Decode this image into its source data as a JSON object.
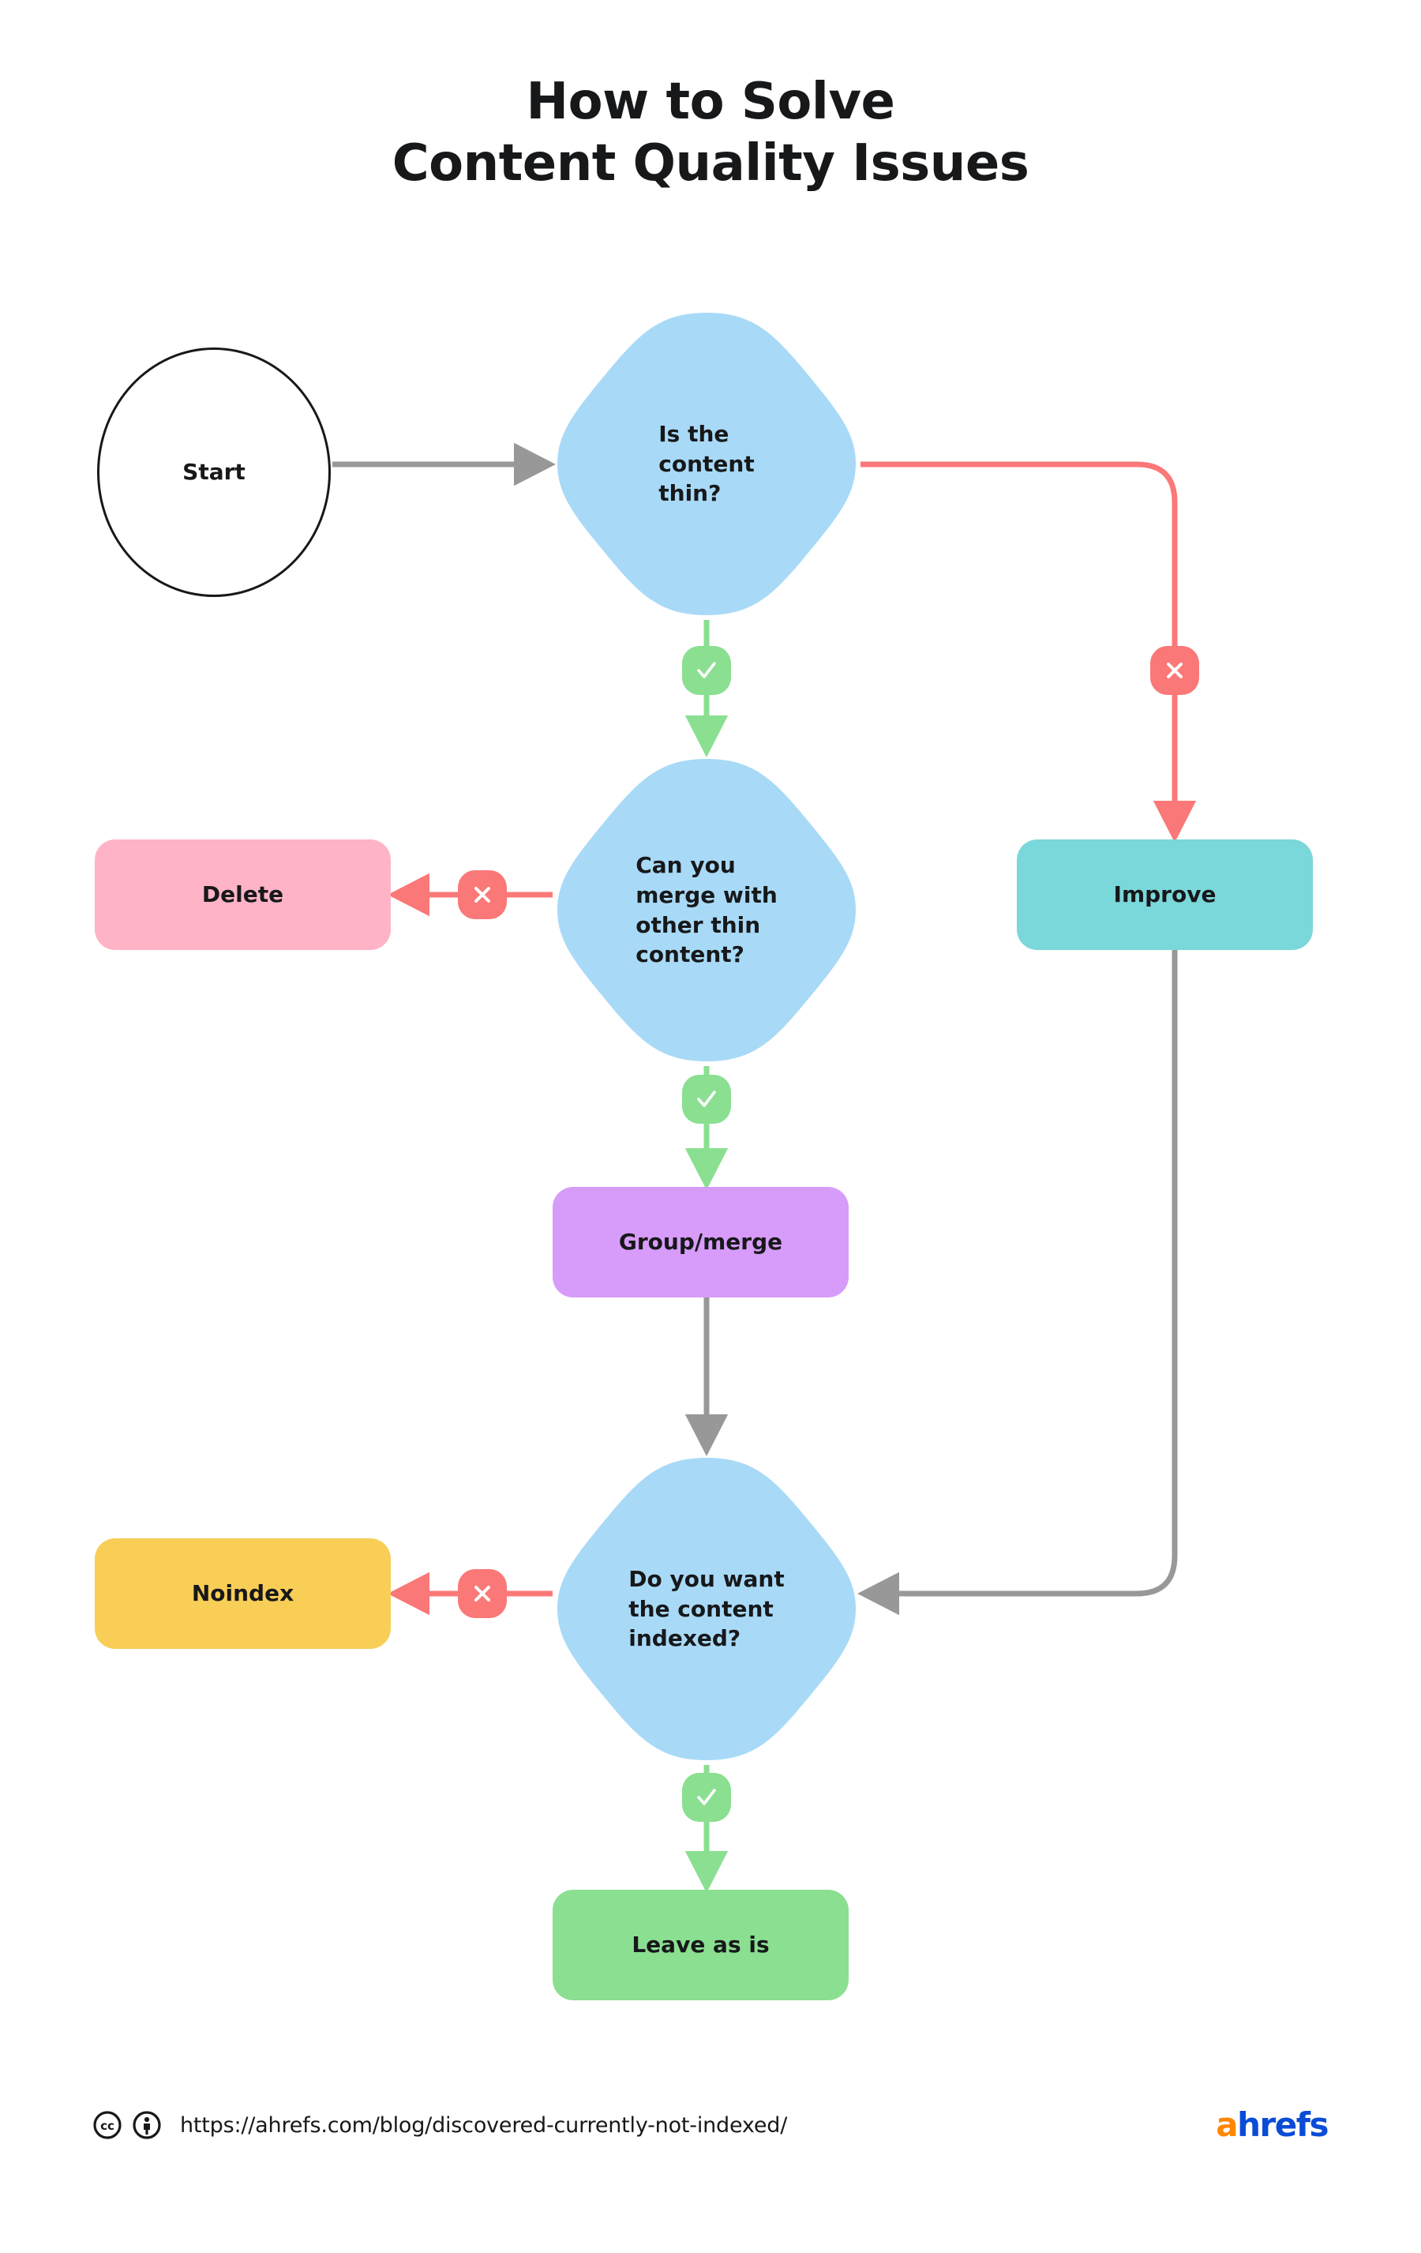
{
  "title": {
    "line1": "How to Solve",
    "line2": "Content Quality Issues"
  },
  "flowchart": {
    "type": "flowchart",
    "nodes": [
      {
        "id": "start",
        "label": "Start",
        "shape": "ellipse",
        "color": "#ffffff"
      },
      {
        "id": "thin",
        "label": "Is the\ncontent\nthin?",
        "shape": "decision",
        "color": "#a8daf7"
      },
      {
        "id": "merge",
        "label": "Can you\nmerge with\nother thin\ncontent?",
        "shape": "decision",
        "color": "#a8daf7"
      },
      {
        "id": "indexed",
        "label": "Do you want\nthe content\nindexed?",
        "shape": "decision",
        "color": "#a8daf7"
      },
      {
        "id": "delete",
        "label": "Delete",
        "shape": "rounded-rect",
        "color": "#ffb3c7"
      },
      {
        "id": "improve",
        "label": "Improve",
        "shape": "rounded-rect",
        "color": "#7ad7da"
      },
      {
        "id": "group",
        "label": "Group/merge",
        "shape": "rounded-rect",
        "color": "#d79cfa"
      },
      {
        "id": "noindex",
        "label": "Noindex",
        "shape": "rounded-rect",
        "color": "#f8ce56"
      },
      {
        "id": "leave",
        "label": "Leave as is",
        "shape": "rounded-rect",
        "color": "#8adf91"
      }
    ],
    "edges": [
      {
        "from": "start",
        "to": "thin",
        "badge": null,
        "color": "#989898"
      },
      {
        "from": "thin",
        "to": "merge",
        "badge": "yes",
        "color": "#8adf91"
      },
      {
        "from": "thin",
        "to": "improve",
        "badge": "no",
        "color": "#fa7877"
      },
      {
        "from": "merge",
        "to": "delete",
        "badge": "no",
        "color": "#fa7877"
      },
      {
        "from": "merge",
        "to": "group",
        "badge": "yes",
        "color": "#8adf91"
      },
      {
        "from": "group",
        "to": "indexed",
        "badge": null,
        "color": "#989898"
      },
      {
        "from": "improve",
        "to": "indexed",
        "badge": null,
        "color": "#989898"
      },
      {
        "from": "indexed",
        "to": "noindex",
        "badge": "no",
        "color": "#fa7877"
      },
      {
        "from": "indexed",
        "to": "leave",
        "badge": "yes",
        "color": "#8adf91"
      }
    ],
    "badges": {
      "yes_icon": "check-icon",
      "no_icon": "cross-icon",
      "yes_color": "#8adf91",
      "no_color": "#fa7877"
    }
  },
  "footer": {
    "license_cc_icon": "creative-commons-icon",
    "license_by_icon": "attribution-person-icon",
    "url": "https://ahrefs.com/blog/discovered-currently-not-indexed/",
    "logo_a": "a",
    "logo_rest": "hrefs"
  }
}
